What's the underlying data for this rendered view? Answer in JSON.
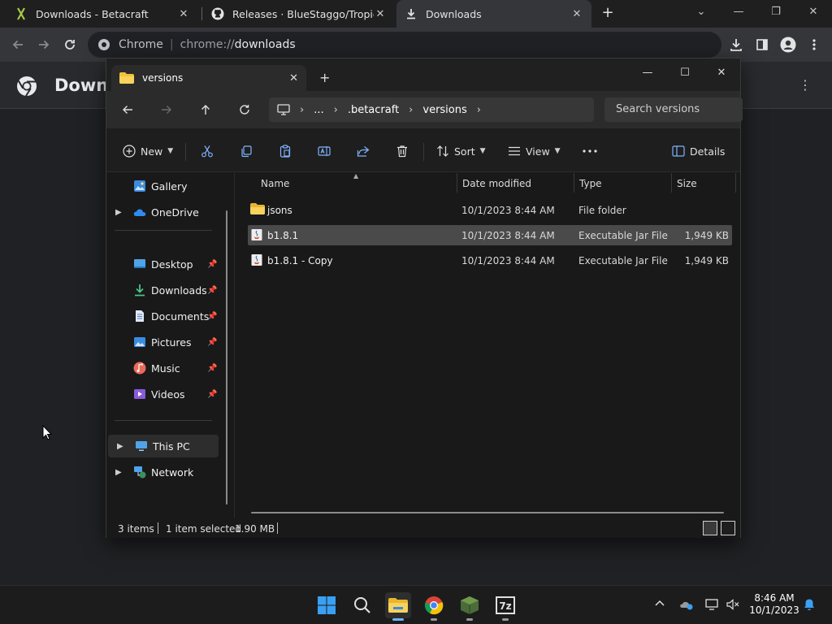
{
  "chrome": {
    "tabs": [
      {
        "title": "Downloads - Betacraft"
      },
      {
        "title": "Releases · BlueStaggo/TropicalAd"
      },
      {
        "title": "Downloads"
      }
    ],
    "omnibox": {
      "chip": "Chrome",
      "scheme": "chrome://",
      "host": "downloads"
    },
    "page_title": "Downloads"
  },
  "explorer": {
    "tab_title": "versions",
    "breadcrumb": [
      "...",
      ".betacraft",
      "versions"
    ],
    "search_placeholder": "Search versions",
    "commands": {
      "new": "New",
      "sort": "Sort",
      "view": "View",
      "details": "Details"
    },
    "nav": {
      "gallery": "Gallery",
      "onedrive": "OneDrive",
      "desktop": "Desktop",
      "downloads": "Downloads",
      "documents": "Documents",
      "pictures": "Pictures",
      "music": "Music",
      "videos": "Videos",
      "this_pc": "This PC",
      "network": "Network"
    },
    "columns": {
      "name": "Name",
      "date": "Date modified",
      "type": "Type",
      "size": "Size"
    },
    "files": [
      {
        "name": "jsons",
        "date": "10/1/2023 8:44 AM",
        "type": "File folder",
        "size": ""
      },
      {
        "name": "b1.8.1",
        "date": "10/1/2023 8:44 AM",
        "type": "Executable Jar File",
        "size": "1,949 KB"
      },
      {
        "name": "b1.8.1 - Copy",
        "date": "10/1/2023 8:44 AM",
        "type": "Executable Jar File",
        "size": "1,949 KB"
      }
    ],
    "status": {
      "items": "3 items",
      "selected": "1 item selected",
      "size": "1.90 MB"
    }
  },
  "taskbar": {
    "time": "8:46 AM",
    "date": "10/1/2023"
  },
  "colors": {
    "accent": "#7fb4ff",
    "folder": "#f0c33c",
    "selection": "#4a4a4a"
  }
}
